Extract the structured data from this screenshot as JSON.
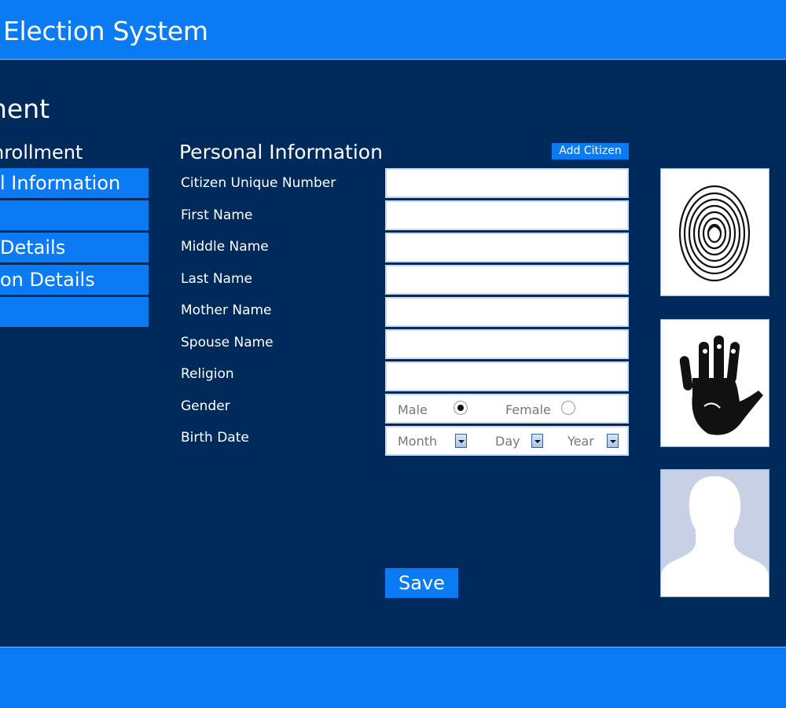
{
  "app": {
    "title": "Election System"
  },
  "page": {
    "heading": "nent"
  },
  "sidebar": {
    "section_label": "nrollment",
    "items": [
      {
        "label": "l Information"
      },
      {
        "label": ""
      },
      {
        "label": "Details"
      },
      {
        "label": "on Details"
      },
      {
        "label": ""
      }
    ]
  },
  "form": {
    "title": "Personal Information",
    "add_button": "Add Citizen",
    "fields": [
      {
        "label": "Citizen Unique Number",
        "value": ""
      },
      {
        "label": "First Name",
        "value": ""
      },
      {
        "label": "Middle Name",
        "value": ""
      },
      {
        "label": "Last Name",
        "value": ""
      },
      {
        "label": "Mother Name",
        "value": ""
      },
      {
        "label": "Spouse Name",
        "value": ""
      },
      {
        "label": "Religion",
        "value": ""
      }
    ],
    "gender": {
      "label": "Gender",
      "options": [
        "Male",
        "Female"
      ],
      "selected": "Male"
    },
    "birth_date": {
      "label": "Birth Date",
      "month": "Month",
      "day": "Day",
      "year": "Year"
    },
    "save_button": "Save"
  },
  "biometrics": {
    "fingerprint": "fingerprint-icon",
    "handprint": "handprint-icon",
    "photo": "user-silhouette-icon"
  },
  "colors": {
    "background": "#002a5a",
    "accent": "#0a7bf2"
  }
}
